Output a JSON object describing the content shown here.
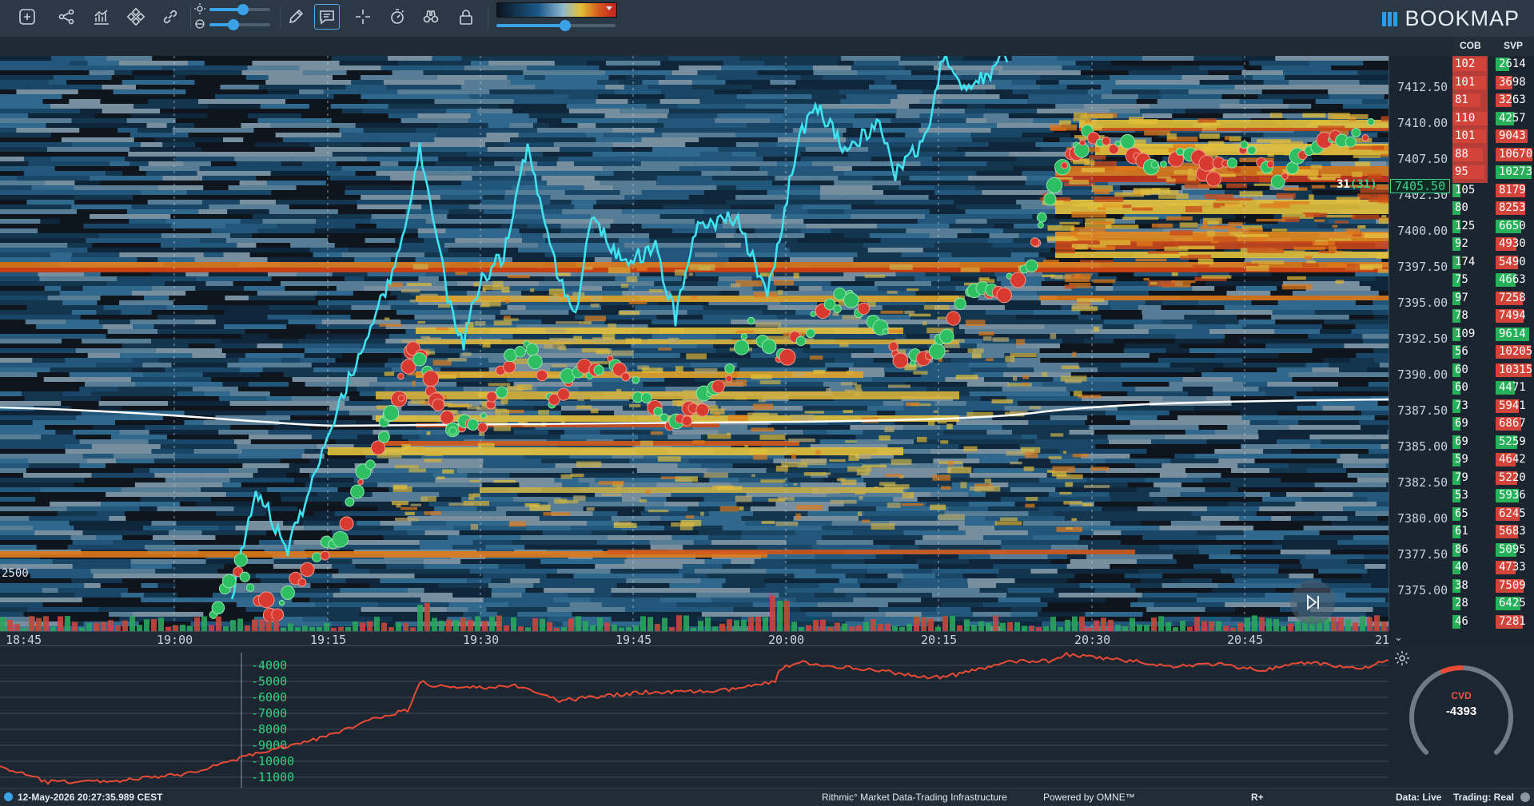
{
  "toolbar": {
    "buttons": [
      {
        "name": "add-indicator-icon"
      },
      {
        "name": "share-icon"
      },
      {
        "name": "chart-icon"
      },
      {
        "name": "drawing-shapes-icon"
      },
      {
        "name": "link-icon"
      },
      {
        "name": "pencil-icon"
      },
      {
        "name": "comment-icon"
      },
      {
        "name": "crosshair-icon"
      },
      {
        "name": "stopwatch-icon"
      },
      {
        "name": "binoculars-icon"
      },
      {
        "name": "lock-icon"
      }
    ],
    "brightness_level": 0.55,
    "contrast_level": 0.4,
    "zoom_level": 0.58
  },
  "brand": {
    "name": "BOOKMAP"
  },
  "columns": {
    "cob": "COB",
    "svp": "SVP"
  },
  "heatmap": {
    "threshold_label": "2500",
    "current_price": "7405.50",
    "current_size": "31",
    "current_size_paren": "(31)"
  },
  "price_axis": [
    "7412.50",
    "7410.00",
    "7407.50",
    "7405.50",
    "7402.50",
    "7400.00",
    "7397.50",
    "7395.00",
    "7392.50",
    "7390.00",
    "7387.50",
    "7385.00",
    "7382.50",
    "7380.00",
    "7377.50",
    "7375.00"
  ],
  "time_axis": [
    "18:45",
    "19:00",
    "19:15",
    "19:30",
    "19:45",
    "20:00",
    "20:15",
    "20:30",
    "20:45",
    "21"
  ],
  "cob": [
    {
      "v": "102",
      "side": "ask"
    },
    {
      "v": "101",
      "side": "ask"
    },
    {
      "v": "81",
      "side": "ask"
    },
    {
      "v": "110",
      "side": "ask"
    },
    {
      "v": "101",
      "side": "ask"
    },
    {
      "v": "88",
      "side": "ask"
    },
    {
      "v": "95",
      "side": "ask"
    },
    {
      "v": "105",
      "side": "bid"
    },
    {
      "v": "80",
      "side": "bid"
    },
    {
      "v": "125",
      "side": "bid"
    },
    {
      "v": "92",
      "side": "bid"
    },
    {
      "v": "174",
      "side": "bid"
    },
    {
      "v": "75",
      "side": "bid"
    },
    {
      "v": "97",
      "side": "bid"
    },
    {
      "v": "78",
      "side": "bid"
    },
    {
      "v": "109",
      "side": "bid"
    },
    {
      "v": "56",
      "side": "bid"
    },
    {
      "v": "60",
      "side": "bid"
    },
    {
      "v": "60",
      "side": "bid"
    },
    {
      "v": "73",
      "side": "bid"
    },
    {
      "v": "69",
      "side": "bid"
    },
    {
      "v": "69",
      "side": "bid"
    },
    {
      "v": "59",
      "side": "bid"
    },
    {
      "v": "79",
      "side": "bid"
    },
    {
      "v": "53",
      "side": "bid"
    },
    {
      "v": "65",
      "side": "bid"
    },
    {
      "v": "61",
      "side": "bid"
    },
    {
      "v": "86",
      "side": "bid"
    },
    {
      "v": "40",
      "side": "bid"
    },
    {
      "v": "38",
      "side": "bid"
    },
    {
      "v": "28",
      "side": "bid"
    },
    {
      "v": "46",
      "side": "bid"
    }
  ],
  "svp": [
    "2614",
    "3698",
    "3263",
    "4257",
    "9043",
    "10670",
    "10273",
    "8179",
    "8253",
    "6650",
    "4930",
    "5490",
    "4663",
    "7258",
    "7494",
    "9614",
    "10205",
    "10315",
    "4471",
    "5941",
    "6867",
    "5259",
    "4642",
    "5220",
    "5936",
    "6245",
    "5683",
    "5095",
    "4733",
    "7509",
    "6425",
    "7281"
  ],
  "cvd": {
    "labels": [
      "-4000",
      "-5000",
      "-6000",
      "-7000",
      "-8000",
      "-9000",
      "-10000",
      "-11000"
    ],
    "gauge_title": "CVD",
    "gauge_value": "-4393",
    "gauge_fraction": 0.42
  },
  "status": {
    "datetime": "12-May-2026 20:27:35.989 CEST",
    "rithmic": "Rithmic° Market Data-Trading Infrastructure",
    "powered": "Powered by OMNE™",
    "r_plus": "R+",
    "data": "Data: Live",
    "trading": "Trading: Real"
  },
  "colors": {
    "price_line": "#3fe3f0",
    "vwap": "#ffffff",
    "ask": "#d2433a",
    "bid": "#27b05a",
    "cvd_line": "#e84a35",
    "accent": "#3aa3e8"
  }
}
